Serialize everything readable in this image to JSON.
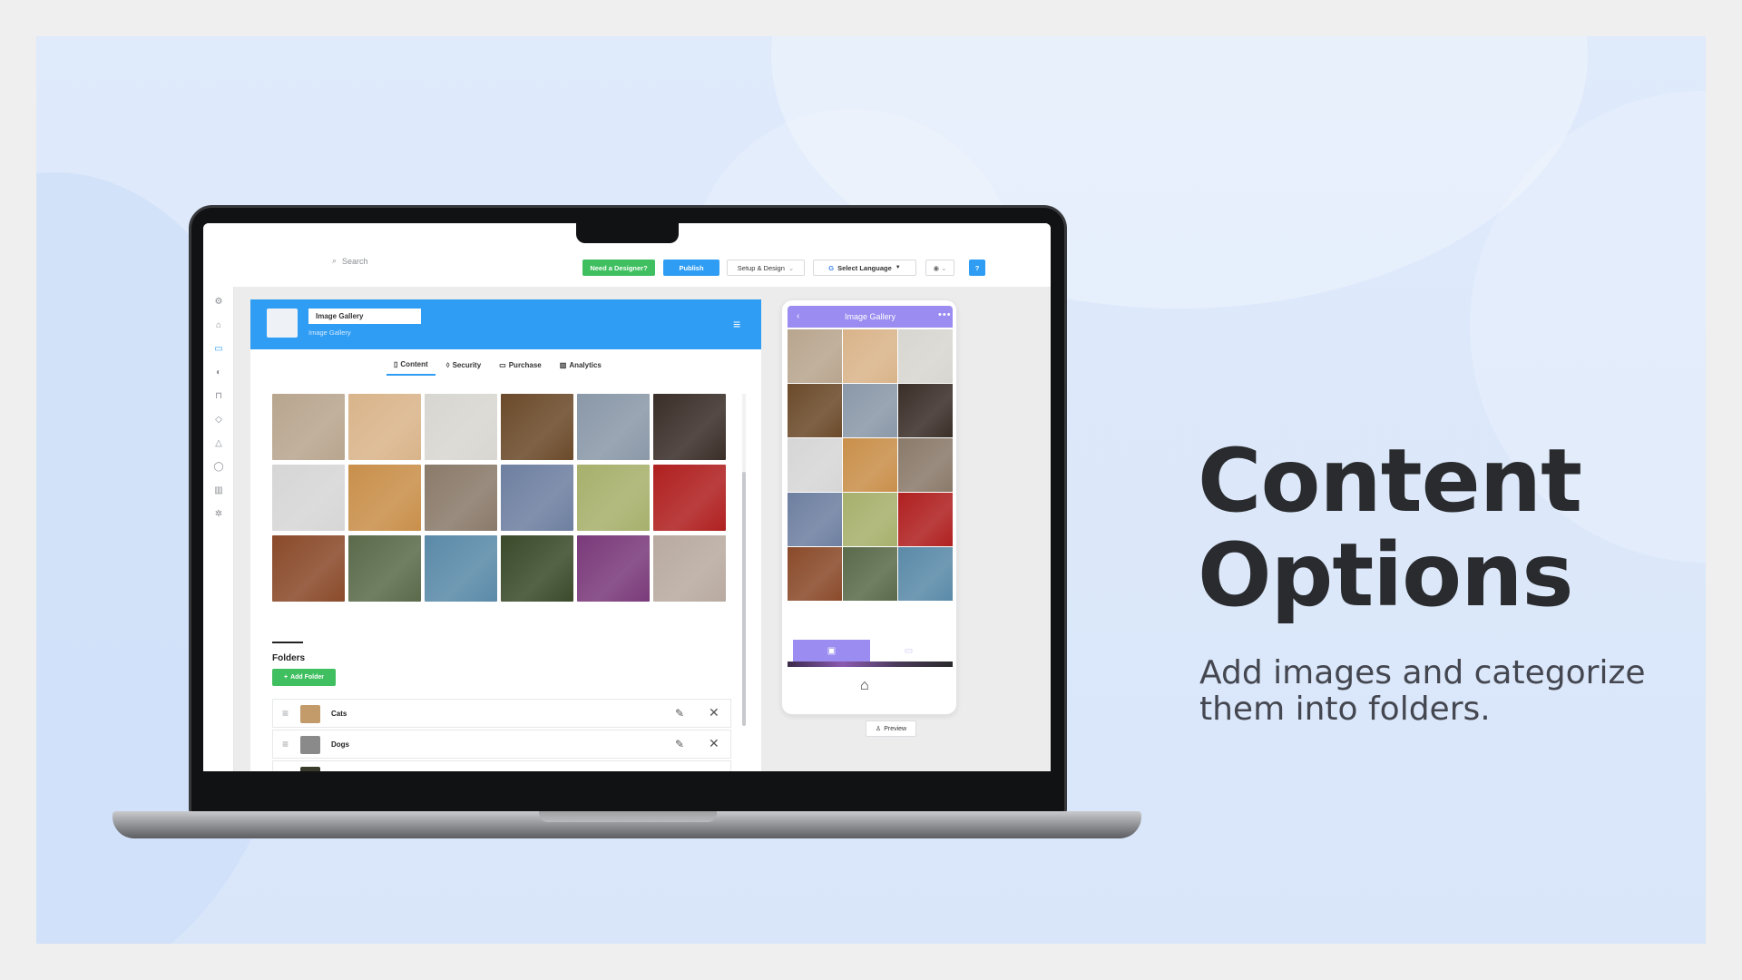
{
  "slide": {
    "headline_line1": "Content",
    "headline_line2": "Options",
    "subline": "Add images and categorize them into folders."
  },
  "topbar": {
    "search_placeholder": "Search",
    "need_designer": "Need a Designer?",
    "publish": "Publish",
    "setup_design": "Setup & Design",
    "select_language": "Select Language",
    "language_caret": "▼"
  },
  "nav_icons": [
    "settings-icon",
    "home-icon",
    "content-icon",
    "design-icon",
    "security-icon",
    "tag-icon",
    "notification-icon",
    "user-icon",
    "analytics-icon",
    "gear-icon"
  ],
  "editor": {
    "title_value": "Image Gallery",
    "subtitle": "Image Gallery",
    "tabs": [
      {
        "label": "Content",
        "icon": "content-icon",
        "active": true
      },
      {
        "label": "Security",
        "icon": "shield-icon",
        "active": false
      },
      {
        "label": "Purchase",
        "icon": "card-icon",
        "active": false
      },
      {
        "label": "Analytics",
        "icon": "chart-icon",
        "active": false
      }
    ],
    "gallery_colors": [
      "#b8a58e",
      "#d9b48a",
      "#d8d6d0",
      "#6b4a2a",
      "#8a98a8",
      "#3a2e28",
      "#d6d6d6",
      "#c98f4a",
      "#8a7a6a",
      "#6e7fa0",
      "#a7b06c",
      "#b02020",
      "#8a4a2a",
      "#5a6a4a",
      "#5a8aa8",
      "#3a4a2a",
      "#7a3a7a",
      "#b8aaa0"
    ],
    "folders_title": "Folders",
    "add_folder": "Add Folder",
    "folders": [
      {
        "name": "Cats",
        "thumb": "#c39a6a"
      },
      {
        "name": "Dogs",
        "thumb": "#8a8a8a"
      }
    ]
  },
  "phone": {
    "title": "Image Gallery",
    "gallery_colors": [
      "#b8a58e",
      "#d9b48a",
      "#d8d6d0",
      "#6b4a2a",
      "#8a98a8",
      "#3a2e28",
      "#d6d6d6",
      "#c98f4a",
      "#8a7a6a",
      "#6e7fa0",
      "#a7b06c",
      "#b02020",
      "#8a4a2a",
      "#5a6a4a",
      "#5a8aa8"
    ],
    "preview": "Preview"
  },
  "colors": {
    "accent": "#2f9df4",
    "green": "#3fbf5f",
    "phone_accent": "#9b8cf1"
  }
}
